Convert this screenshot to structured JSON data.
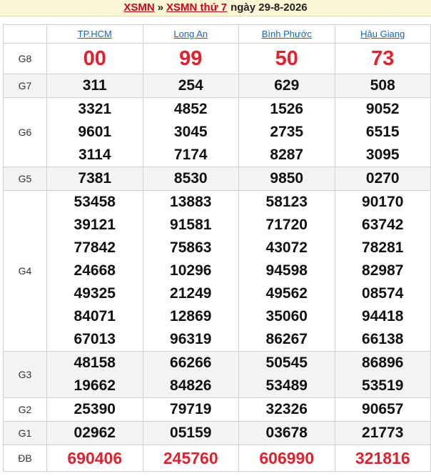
{
  "header": {
    "link1": "XSMN",
    "separator": "»",
    "link2": "XSMN thứ 7",
    "date_text": "ngày 29-8-2026"
  },
  "provinces": [
    "TP.HCM",
    "Long An",
    "Bình Phước",
    "Hậu Giang"
  ],
  "prizes": [
    {
      "label": "G8",
      "style": "big",
      "grey": false,
      "values": [
        [
          "00"
        ],
        [
          "99"
        ],
        [
          "50"
        ],
        [
          "73"
        ]
      ]
    },
    {
      "label": "G7",
      "style": "normal",
      "grey": true,
      "values": [
        [
          "311"
        ],
        [
          "254"
        ],
        [
          "629"
        ],
        [
          "508"
        ]
      ]
    },
    {
      "label": "G6",
      "style": "normal",
      "grey": false,
      "values": [
        [
          "3321",
          "9601",
          "3114"
        ],
        [
          "4852",
          "3045",
          "7174"
        ],
        [
          "1526",
          "2735",
          "8287"
        ],
        [
          "9052",
          "6515",
          "3095"
        ]
      ]
    },
    {
      "label": "G5",
      "style": "normal",
      "grey": true,
      "values": [
        [
          "7381"
        ],
        [
          "8530"
        ],
        [
          "9850"
        ],
        [
          "0270"
        ]
      ]
    },
    {
      "label": "G4",
      "style": "normal",
      "grey": false,
      "values": [
        [
          "53458",
          "39121",
          "77842",
          "24668",
          "49325",
          "84071",
          "67013"
        ],
        [
          "13883",
          "91581",
          "75863",
          "10296",
          "21249",
          "12869",
          "96319"
        ],
        [
          "58123",
          "71720",
          "43072",
          "94598",
          "49562",
          "35060",
          "86267"
        ],
        [
          "90170",
          "63742",
          "78281",
          "82987",
          "08574",
          "94418",
          "66138"
        ]
      ]
    },
    {
      "label": "G3",
      "style": "normal",
      "grey": true,
      "values": [
        [
          "48158",
          "19662"
        ],
        [
          "66266",
          "84826"
        ],
        [
          "50545",
          "53489"
        ],
        [
          "86896",
          "53519"
        ]
      ]
    },
    {
      "label": "G2",
      "style": "normal",
      "grey": false,
      "values": [
        [
          "25390"
        ],
        [
          "79719"
        ],
        [
          "32326"
        ],
        [
          "90657"
        ]
      ]
    },
    {
      "label": "G1",
      "style": "normal",
      "grey": true,
      "values": [
        [
          "02962"
        ],
        [
          "05159"
        ],
        [
          "03678"
        ],
        [
          "21773"
        ]
      ]
    },
    {
      "label": "ĐB",
      "style": "db",
      "grey": false,
      "values": [
        [
          "690406"
        ],
        [
          "245760"
        ],
        [
          "606990"
        ],
        [
          "321816"
        ]
      ]
    }
  ]
}
